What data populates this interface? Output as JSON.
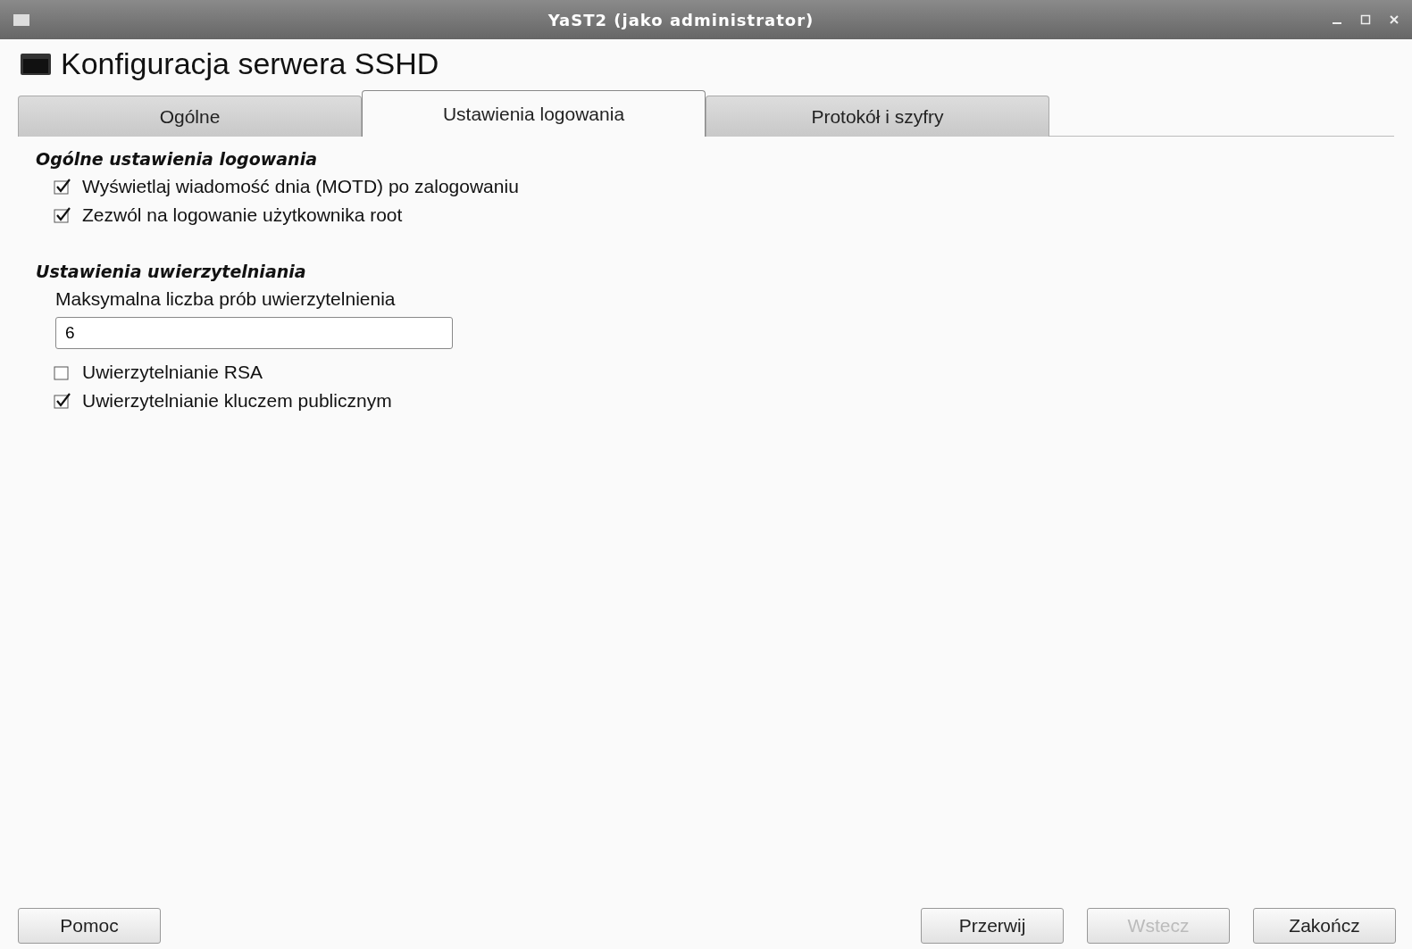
{
  "window": {
    "title": "YaST2 (jako administrator)"
  },
  "header": {
    "title": "Konfiguracja serwera SSHD"
  },
  "tabs": [
    {
      "label": "Ogólne",
      "selected": false
    },
    {
      "label": "Ustawienia logowania",
      "selected": true
    },
    {
      "label": "Protokół i szyfry",
      "selected": false
    }
  ],
  "sections": [
    {
      "title": "Ogólne ustawienia logowania",
      "items": [
        {
          "kind": "checkbox",
          "label": "Wyświetlaj wiadomość dnia (MOTD) po zalogowaniu",
          "checked": true
        },
        {
          "kind": "checkbox",
          "label": "Zezwól na logowanie użytkownika root",
          "checked": true
        }
      ]
    },
    {
      "title": "Ustawienia uwierzytelniania",
      "items": [
        {
          "kind": "field",
          "label": "Maksymalna liczba prób uwierzytelnienia",
          "value": "6"
        },
        {
          "kind": "checkbox",
          "label": "Uwierzytelnianie RSA",
          "checked": false
        },
        {
          "kind": "checkbox",
          "label": "Uwierzytelnianie kluczem publicznym",
          "checked": true
        }
      ]
    }
  ],
  "footer": {
    "left_buttons": [
      {
        "label": "Pomoc",
        "disabled": false
      }
    ],
    "right_buttons": [
      {
        "label": "Przerwij",
        "disabled": false
      },
      {
        "label": "Wstecz",
        "disabled": true
      },
      {
        "label": "Zakończ",
        "disabled": false
      }
    ]
  }
}
